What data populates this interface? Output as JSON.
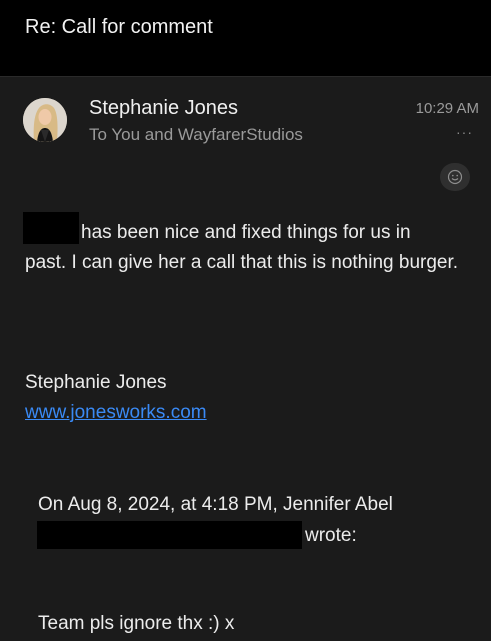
{
  "email": {
    "subject": "Re: Call for comment",
    "sender_name": "Stephanie Jones",
    "recipients": "To You and WayfarerStudios",
    "time": "10:29 AM",
    "more_glyph": "···",
    "react_icon": "smiley-icon",
    "body_line1": "has been nice and fixed things for us in",
    "body_rest": "past. I can give her a call that this is nothing burger.",
    "signature_name": "Stephanie Jones",
    "signature_link": "www.jonesworks.com",
    "quote_header": "On Aug 8, 2024, at 4:18 PM, Jennifer Abel",
    "quote_wrote": "wrote:",
    "quote_body": "Team pls ignore thx :) x"
  },
  "colors": {
    "background": "#1b1b1b",
    "header_background": "#000000",
    "link": "#3a8af5",
    "secondary_text": "#9a9a9a",
    "redaction": "#000000"
  }
}
